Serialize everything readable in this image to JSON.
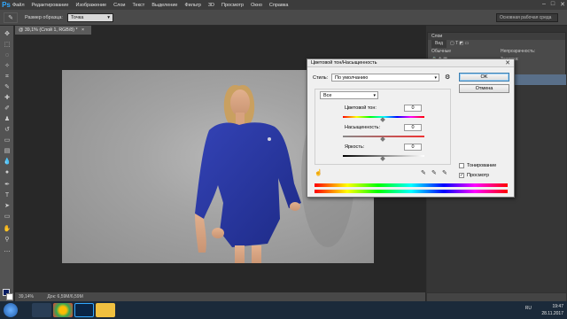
{
  "app": {
    "logo": "Ps"
  },
  "menu": [
    "Файл",
    "Редактирование",
    "Изображение",
    "Слои",
    "Текст",
    "Выделение",
    "Фильтр",
    "3D",
    "Просмотр",
    "Окно",
    "Справка"
  ],
  "window_buttons": {
    "minimize": "–",
    "maximize": "□",
    "close": "✕"
  },
  "options": {
    "tool_icon": "eyedropper-icon",
    "sample_size_label": "Размер образца:",
    "sample_size_value": "Точка",
    "workspace": "Основная рабочая среда"
  },
  "document": {
    "tab_title": "@ 39,1% (Слой 1, RGB/8) *",
    "tab_close": "×",
    "zoom": "39,14%",
    "doc_info": "Док: 6,59M/6,59M"
  },
  "layers_panel": {
    "tab": "Слои",
    "kind_label": "Вид",
    "blend_mode": "Обычные",
    "opacity_label": "Непрозрачность:",
    "fill_label": "Заливка:"
  },
  "dialog": {
    "title": "Цветовой тон/Насыщенность",
    "close": "✕",
    "preset_label": "Стиль:",
    "preset_value": "По умолчанию",
    "channel": "Все",
    "ok": "OK",
    "cancel": "Отмена",
    "hue_label": "Цветовой тон:",
    "hue_value": "0",
    "saturation_label": "Насыщенность:",
    "saturation_value": "0",
    "lightness_label": "Яркость:",
    "lightness_value": "0",
    "colorize_label": "Тонирование",
    "colorize_checked": false,
    "preview_label": "Просмотр",
    "preview_checked": true
  },
  "taskbar": {
    "lang": "RU",
    "time": "19:47",
    "date": "28.11.2017"
  },
  "colors": {
    "foreground": "#0a1e63",
    "background": "#ffffff",
    "dress": "#2838a0",
    "accent": "#31a8ff"
  }
}
